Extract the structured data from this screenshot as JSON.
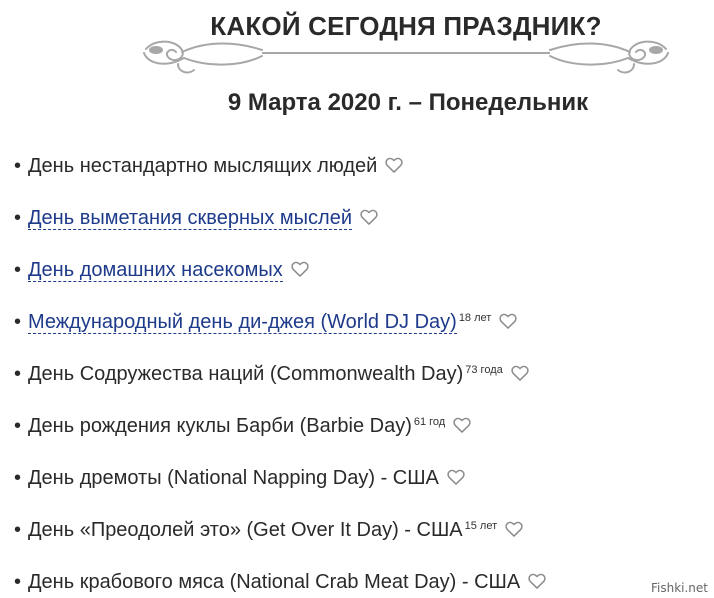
{
  "header": {
    "title": "КАКОЙ СЕГОДНЯ ПРАЗДНИК?",
    "date": "9 Марта 2020 г. – Понедельник"
  },
  "holidays": [
    {
      "name": "День нестандартно мыслящих людей",
      "age": ""
    },
    {
      "name": "День выметания скверных мыслей",
      "age": ""
    },
    {
      "name": "День домашних насекомых",
      "age": ""
    },
    {
      "name": "Международный день ди-джея (World DJ Day)",
      "age": "18 лет"
    },
    {
      "name": "День Содружества наций (Commonwealth Day)",
      "age": "73 года"
    },
    {
      "name": "День рождения куклы Барби (Barbie Day)",
      "age": "61 год"
    },
    {
      "name": "День дремоты (National Napping Day) - США",
      "age": ""
    },
    {
      "name": "День «Преодолей это» (Get Over It Day) - США",
      "age": "15 лет"
    },
    {
      "name": "День крабового мяса (National Crab Meat Day) - США",
      "age": ""
    }
  ],
  "colors": {
    "link": "#1e3a8a",
    "text": "#2a2a2a",
    "ornament": "#a7a7a7"
  },
  "icons": {
    "heart": "heart-outline-icon",
    "ornament": "decorative-scroll-ornament"
  },
  "watermark": "Fishki.net"
}
